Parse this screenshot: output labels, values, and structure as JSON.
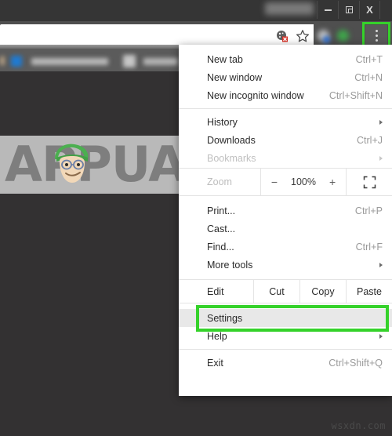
{
  "window": {
    "title_blurred": "",
    "controls": [
      {
        "name": "minimize",
        "glyph": "minimize-icon"
      },
      {
        "name": "restore",
        "glyph": "restore-icon"
      },
      {
        "name": "close",
        "glyph": "close-icon",
        "label": "X"
      }
    ]
  },
  "toolbar": {
    "cookie_icon": "cookie-blocked-icon",
    "bookmark_star_icon": "star-icon",
    "menu_icon": "three-dot-menu-icon",
    "extension_icons": [
      "extension-icon-1",
      "extension-icon-2"
    ]
  },
  "bookmarks_bar": {
    "items": [
      {
        "label": "",
        "favicon": "blue-favicon"
      },
      {
        "label": "",
        "favicon": "grey-favicon"
      }
    ]
  },
  "menu": {
    "groups": [
      {
        "items": [
          {
            "label": "New tab",
            "accel": "Ctrl+T",
            "submenu": false,
            "disabled": false
          },
          {
            "label": "New window",
            "accel": "Ctrl+N",
            "submenu": false,
            "disabled": false
          },
          {
            "label": "New incognito window",
            "accel": "Ctrl+Shift+N",
            "submenu": false,
            "disabled": false
          }
        ]
      },
      {
        "items": [
          {
            "label": "History",
            "accel": "",
            "submenu": true,
            "disabled": false
          },
          {
            "label": "Downloads",
            "accel": "Ctrl+J",
            "submenu": false,
            "disabled": false
          },
          {
            "label": "Bookmarks",
            "accel": "",
            "submenu": true,
            "disabled": true
          }
        ]
      }
    ],
    "zoom_row": {
      "label": "Zoom",
      "minus": "−",
      "value": "100%",
      "plus": "+",
      "fullscreen_icon": "fullscreen-icon"
    },
    "group3": {
      "items": [
        {
          "label": "Print...",
          "accel": "Ctrl+P",
          "submenu": false,
          "disabled": false
        },
        {
          "label": "Cast...",
          "accel": "",
          "submenu": false,
          "disabled": false
        },
        {
          "label": "Find...",
          "accel": "Ctrl+F",
          "submenu": false,
          "disabled": false
        },
        {
          "label": "More tools",
          "accel": "",
          "submenu": true,
          "disabled": false
        }
      ]
    },
    "edit_row": {
      "label": "Edit",
      "cut": "Cut",
      "copy": "Copy",
      "paste": "Paste"
    },
    "group4": {
      "items": [
        {
          "label": "Settings",
          "accel": "",
          "submenu": false,
          "disabled": false,
          "highlighted": true
        },
        {
          "label": "Help",
          "accel": "",
          "submenu": true,
          "disabled": false
        }
      ]
    },
    "group5": {
      "items": [
        {
          "label": "Exit",
          "accel": "Ctrl+Shift+Q",
          "submenu": false,
          "disabled": false
        }
      ]
    }
  },
  "watermark": {
    "text": "APPUALS",
    "mascot": "appuals-mascot-icon",
    "corner_text": "wsxdn.com"
  },
  "annotations": {
    "highlight_color": "#35d22a",
    "targets": [
      "three-dot-menu-button",
      "settings-menu-item"
    ]
  }
}
